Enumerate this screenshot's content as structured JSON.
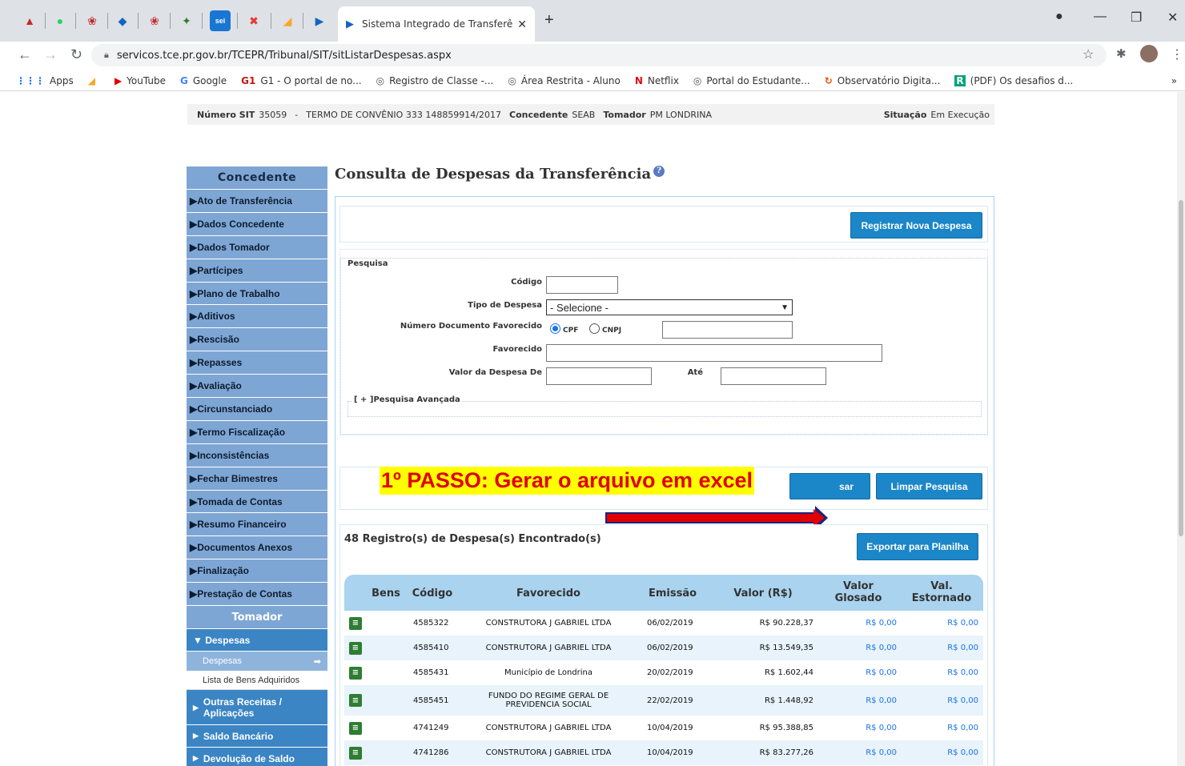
{
  "browser": {
    "tab_title": "Sistema Integrado de Transferênc",
    "url": "servicos.tce.pr.gov.br/TCEPR/Tribunal/SIT/sitListarDespesas.aspx",
    "bookmarks": [
      "Apps",
      "",
      "YouTube",
      "Google",
      "G1 - O portal de no...",
      "Registro de Classe -...",
      "Área Restrita - Aluno",
      "Netflix",
      "Portal do Estudante...",
      "Observatório Digita...",
      "(PDF) Os desafios d..."
    ]
  },
  "info": {
    "numero_label": "Número SIT",
    "numero": "35059",
    "dash": "-",
    "termo": "TERMO DE CONVÊNIO 333 148859914/2017",
    "concedente_label": "Concedente",
    "concedente": "SEAB",
    "tomador_label": "Tomador",
    "tomador": "PM LONDRINA",
    "situacao_label": "Situação",
    "situacao": "Em Execução"
  },
  "sidebar": {
    "concedente_header": "Concedente",
    "items": [
      "▶Ato de Transferência",
      "▶Dados Concedente",
      "▶Dados Tomador",
      "▶Partícipes",
      "▶Plano de Trabalho",
      "▶Aditivos",
      "▶Rescisão",
      "▶Repasses",
      "▶Avaliação",
      "▶Circunstanciado",
      "▶Termo Fiscalização",
      "▶Inconsistências",
      "▶Fechar Bimestres",
      "▶Tomada de Contas",
      "▶Resumo Financeiro",
      "▶Documentos Anexos",
      "▶Finalização",
      "▶Prestação de Contas"
    ],
    "tomador_header": "Tomador",
    "despesas": "▼ Despesas",
    "sub_despesas": "Despesas",
    "sub_bens": "Lista de Bens Adquiridos",
    "outras": "Outras Receitas / Aplicações",
    "saldo": "Saldo Bancário",
    "devolucao": "Devolução de Saldo"
  },
  "main": {
    "title": "Consulta de Despesas da Transferência",
    "btn_registrar": "Registrar Nova Despesa",
    "pesquisa_legend": "Pesquisa",
    "lbl_codigo": "Código",
    "lbl_tipo": "Tipo de Despesa",
    "tipo_selected": "- Selecione -",
    "lbl_numdoc": "Número Documento Favorecido",
    "lbl_cpf": "CPF",
    "lbl_cnpj": "CNPJ",
    "lbl_favorecido": "Favorecido",
    "lbl_valor_de": "Valor da Despesa De",
    "lbl_ate": "Até",
    "adv": "[ + ]Pesquisa Avançada",
    "btn_pesquisar_tail": "sar",
    "btn_limpar": "Limpar Pesquisa",
    "annotation": "1º PASSO: Gerar o arquivo em excel",
    "count": "48 Registro(s) de Despesa(s) Encontrado(s)",
    "btn_exportar": "Exportar para Planilha"
  },
  "table": {
    "headers": [
      "Bens",
      "Código",
      "Favorecido",
      "Emissão",
      "Valor (R$)",
      "Valor Glosado",
      "Val. Estornado"
    ],
    "rows": [
      {
        "codigo": "4585322",
        "favorecido": "CONSTRUTORA J GABRIEL LTDA",
        "emissao": "06/02/2019",
        "valor": "R$ 90.228,37",
        "glosado": "R$ 0,00",
        "estornado": "R$ 0,00"
      },
      {
        "codigo": "4585410",
        "favorecido": "CONSTRUTORA J GABRIEL LTDA",
        "emissao": "06/02/2019",
        "valor": "R$ 13.549,35",
        "glosado": "R$ 0,00",
        "estornado": "R$ 0,00"
      },
      {
        "codigo": "4585431",
        "favorecido": "Município de Londrina",
        "emissao": "20/02/2019",
        "valor": "R$ 1.602,44",
        "glosado": "R$ 0,00",
        "estornado": "R$ 0,00"
      },
      {
        "codigo": "4585451",
        "favorecido": "FUNDO DO REGIME GERAL DE PREVIDENCIA SOCIAL",
        "emissao": "22/02/2019",
        "valor": "R$ 1.448,92",
        "glosado": "R$ 0,00",
        "estornado": "R$ 0,00"
      },
      {
        "codigo": "4741249",
        "favorecido": "CONSTRUTORA J GABRIEL LTDA",
        "emissao": "10/04/2019",
        "valor": "R$ 95.388,85",
        "glosado": "R$ 0,00",
        "estornado": "R$ 0,00"
      },
      {
        "codigo": "4741286",
        "favorecido": "CONSTRUTORA J GABRIEL LTDA",
        "emissao": "10/04/2019",
        "valor": "R$ 83.277,26",
        "glosado": "R$ 0,00",
        "estornado": "R$ 0,00"
      }
    ]
  },
  "colors": {
    "accent": "#1b86c8",
    "sidebar": "#7ea6d4",
    "annotation_bg": "#ffff00",
    "annotation_text": "#e00000",
    "arrow": "#e00000"
  }
}
